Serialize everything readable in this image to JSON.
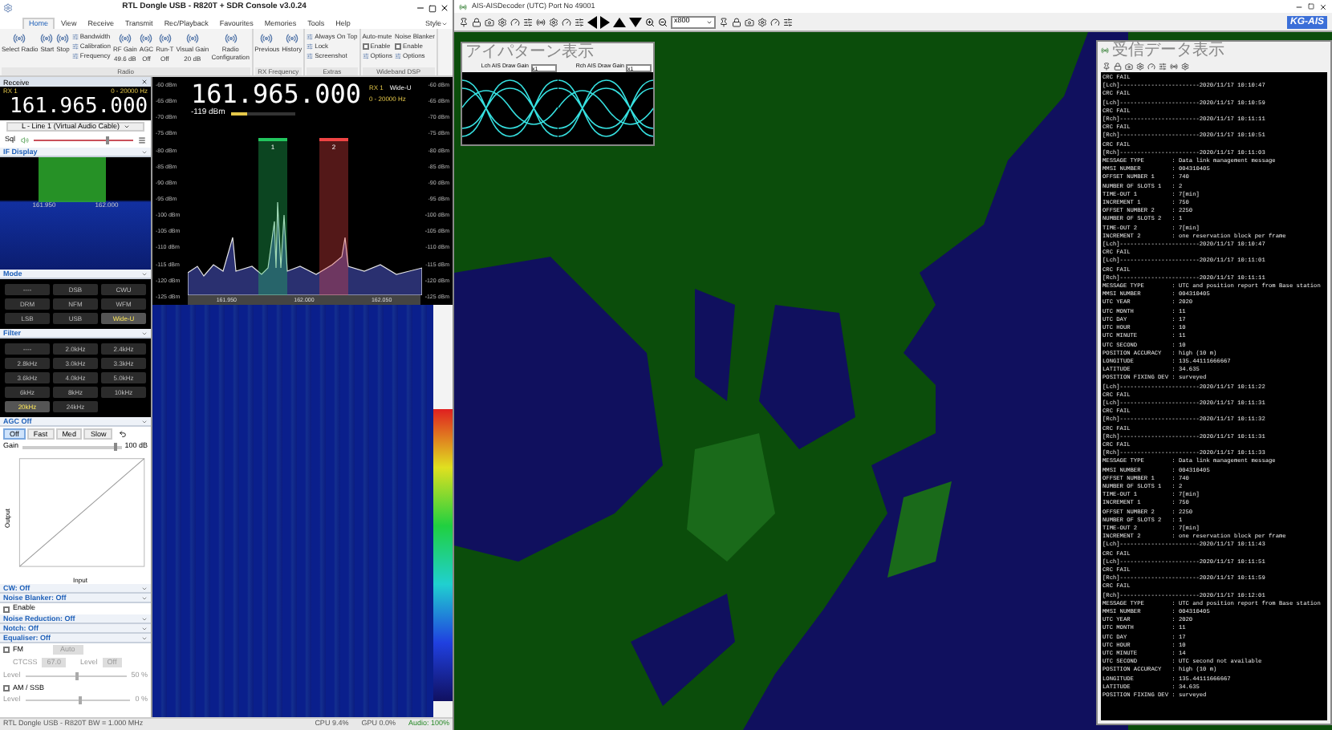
{
  "sdr": {
    "title": "RTL Dongle USB - R820T + SDR Console v3.0.24",
    "tabs": [
      {
        "label": "Home",
        "selected": true
      },
      {
        "label": "View",
        "selected": false
      },
      {
        "label": "Receive",
        "selected": false
      },
      {
        "label": "Transmit",
        "selected": false
      },
      {
        "label": "Rec/Playback",
        "selected": false
      },
      {
        "label": "Favourites",
        "selected": false
      },
      {
        "label": "Memories",
        "selected": false
      },
      {
        "label": "Tools",
        "selected": false
      },
      {
        "label": "Help",
        "selected": false
      }
    ],
    "style": "Style",
    "groups": [
      {
        "label": "Radio",
        "columns": [
          [
            {
              "kind": "large",
              "label": "Select Radio"
            }
          ],
          [
            {
              "kind": "large",
              "label": "Start"
            }
          ],
          [
            {
              "kind": "large",
              "label": "Stop"
            }
          ],
          [
            {
              "kind": "small",
              "label": "Bandwidth"
            },
            {
              "kind": "small",
              "label": "Calibration"
            },
            {
              "kind": "small",
              "label": "Frequency"
            }
          ],
          [
            {
              "kind": "large",
              "label": "RF Gain",
              "value": "49.6 dB"
            }
          ],
          [
            {
              "kind": "large",
              "label": "AGC",
              "value": "Off"
            }
          ],
          [
            {
              "kind": "large",
              "label": "Run-T",
              "value": "Off"
            }
          ],
          [
            {
              "kind": "large",
              "label": "Visual Gain",
              "value": "20 dB"
            }
          ],
          [
            {
              "kind": "large",
              "label": "Radio Configuration"
            }
          ]
        ]
      },
      {
        "label": "RX Frequency",
        "columns": [
          [
            {
              "kind": "large",
              "label": "Previous"
            }
          ],
          [
            {
              "kind": "large",
              "label": "History"
            }
          ]
        ]
      },
      {
        "label": "Extras",
        "columns": [
          [
            {
              "kind": "small",
              "label": "Always On Top"
            },
            {
              "kind": "small",
              "label": "Lock"
            },
            {
              "kind": "small",
              "label": "Screenshot"
            }
          ]
        ]
      },
      {
        "label": "Wideband DSP",
        "columns": [
          [
            {
              "kind": "heading",
              "label": "Auto-mute"
            },
            {
              "kind": "check",
              "label": "Enable",
              "checked": false
            },
            {
              "kind": "small",
              "label": "Options"
            }
          ],
          [
            {
              "kind": "heading",
              "label": "Noise Blanker"
            },
            {
              "kind": "check",
              "label": "Enable",
              "checked": false
            },
            {
              "kind": "small",
              "label": "Options"
            }
          ]
        ]
      }
    ],
    "receive": {
      "title": "Receive",
      "rx": "RX 1",
      "range": "0 - 20000 Hz",
      "frequency": "161.965.000",
      "audio_device": "L - Line 1 (Virtual Audio Cable)",
      "squelch": "Sql",
      "volume": {
        "level": 0.72
      }
    },
    "sections": [
      {
        "kind": "if_display",
        "title": "IF Display",
        "labels": [
          "161.950",
          "162.000"
        ]
      },
      {
        "kind": "buttons",
        "title": "Mode",
        "buttons": [
          {
            "label": "----",
            "selected": false
          },
          {
            "label": "DSB",
            "selected": false
          },
          {
            "label": "CWU",
            "selected": false
          },
          {
            "label": "DRM",
            "selected": false
          },
          {
            "label": "NFM",
            "selected": false
          },
          {
            "label": "WFM",
            "selected": false
          },
          {
            "label": "LSB",
            "selected": false
          },
          {
            "label": "USB",
            "selected": false
          },
          {
            "label": "Wide-U",
            "selected": true
          }
        ]
      },
      {
        "kind": "buttons",
        "title": "Filter",
        "buttons": [
          {
            "label": "----",
            "selected": false
          },
          {
            "label": "2.0kHz",
            "selected": false
          },
          {
            "label": "2.4kHz",
            "selected": false
          },
          {
            "label": "2.8kHz",
            "selected": false
          },
          {
            "label": "3.0kHz",
            "selected": false
          },
          {
            "label": "3.3kHz",
            "selected": false
          },
          {
            "label": "3.6kHz",
            "selected": false
          },
          {
            "label": "4.0kHz",
            "selected": false
          },
          {
            "label": "5.0kHz",
            "selected": false
          },
          {
            "label": "6kHz",
            "selected": false
          },
          {
            "label": "8kHz",
            "selected": false
          },
          {
            "label": "10kHz",
            "selected": false
          },
          {
            "label": "20kHz",
            "selected": true
          },
          {
            "label": "24kHz",
            "selected": false
          }
        ]
      },
      {
        "kind": "agc",
        "title": "AGC Off",
        "modes": [
          {
            "label": "Off",
            "selected": true
          },
          {
            "label": "Fast",
            "selected": false
          },
          {
            "label": "Med",
            "selected": false
          },
          {
            "label": "Slow",
            "selected": false
          }
        ],
        "gain_label": "Gain",
        "gain_value": "100 dB",
        "gain": {
          "level": 0.92
        },
        "xlabel": "Input",
        "ylabel": "Output"
      },
      {
        "kind": "header",
        "title": "CW: Off"
      },
      {
        "kind": "header",
        "title": "Noise Blanker: Off"
      },
      {
        "kind": "check",
        "label": "Enable",
        "checked": false
      },
      {
        "kind": "header",
        "title": "Noise Reduction: Off"
      },
      {
        "kind": "header",
        "title": "Notch: Off"
      },
      {
        "kind": "header",
        "title": "Equaliser: Off"
      },
      {
        "kind": "fm",
        "label": "FM",
        "checked": false,
        "button": "Auto",
        "ctcss": "CTCSS",
        "ctcss_value": "67.0",
        "level_label": "Level",
        "level_value": "Off"
      },
      {
        "kind": "slider",
        "label": "Level",
        "value": "50 %",
        "level": 0.5
      },
      {
        "kind": "check",
        "label": "AM / SSB",
        "checked": false
      },
      {
        "kind": "slider",
        "label": "Level",
        "value": "0 %",
        "level": 0.5
      }
    ],
    "display": {
      "frequency": "161.965.000",
      "rx": "RX 1",
      "mode": "Wide-U",
      "range": "0 - 20000 Hz",
      "signal": "-119 dBm",
      "meter": {
        "level": 0.25
      },
      "y_labels_left": [
        "-60 dBm",
        "-65 dBm",
        "-70 dBm",
        "-75 dBm",
        "-80 dBm",
        "-85 dBm",
        "-90 dBm",
        "-95 dBm",
        "-100 dBm",
        "-105 dBm",
        "-110 dBm",
        "-115 dBm",
        "-120 dBm",
        "-125 dBm"
      ],
      "y_labels_right": [
        "-60 dBm",
        "-65 dBm",
        "-70 dBm",
        "-75 dBm",
        "-80 dBm",
        "-85 dBm",
        "-90 dBm",
        "-95 dBm",
        "-100 dBm",
        "-105 dBm",
        "-110 dBm",
        "-115 dBm",
        "-120 dBm",
        "-125 dBm"
      ],
      "x_labels": [
        "161.950",
        "162.000",
        "162.050"
      ],
      "vfos": [
        {
          "label": "1",
          "color": "#22c55e"
        },
        {
          "label": "2",
          "color": "#ef4444"
        }
      ]
    },
    "status": {
      "left": "RTL Dongle USB - R820T BW = 1.000 MHz",
      "cpu": "CPU 9.4%",
      "gpu": "GPU 0.0%",
      "audio": "Audio: 100%"
    }
  },
  "decoder": {
    "title": "AIS-AISDecoder (UTC) Port No 49001",
    "zoom": "x800",
    "logo": "KG-AIS",
    "eye_window": {
      "title": "アイパターン表示",
      "channels": [
        {
          "label": "Lch AIS Draw Gain",
          "gain": "x1"
        },
        {
          "label": "Rch AIS Draw Gain",
          "gain": "x1"
        }
      ]
    },
    "log_window": {
      "title": "受信データ表示",
      "lines": [
        "CRC FAIL",
        "[Lch]-----------------------2020/11/17 10:10:47",
        "CRC FAIL",
        "[Lch]-----------------------2020/11/17 10:10:59",
        "CRC FAIL",
        "[Rch]-----------------------2020/11/17 10:11:11",
        "CRC FAIL",
        "[Rch]-----------------------2020/11/17 10:10:51",
        "CRC FAIL",
        "[Rch]-----------------------2020/11/17 10:11:03",
        "MESSAGE TYPE        : Data link management message",
        "MMSI NUMBER         : 004310405",
        "OFFSET NUMBER 1     : 740",
        "NUMBER OF SLOTS 1   : 2",
        "TIME-OUT 1          : 7[min]",
        "INCREMENT 1         : 750",
        "OFFSET NUMBER 2     : 2250",
        "NUMBER OF SLOTS 2   : 1",
        "TIME-OUT 2          : 7[min]",
        "INCREMENT 2         : one reservation block per frame",
        "[Lch]-----------------------2020/11/17 10:10:47",
        "CRC FAIL",
        "[Lch]-----------------------2020/11/17 10:11:01",
        "CRC FAIL",
        "[Rch]-----------------------2020/11/17 10:11:11",
        "MESSAGE TYPE        : UTC and position report from Base station",
        "MMSI NUMBER         : 004310405",
        "UTC YEAR            : 2020",
        "UTC MONTH           : 11",
        "UTC DAY             : 17",
        "UTC HOUR            : 10",
        "UTC MINUTE          : 11",
        "UTC SECOND          : 10",
        "POSITION ACCURACY   : high (10 m)",
        "LONGITUDE           : 135.44111666667",
        "LATITUDE            : 34.635",
        "POSITION FIXING DEV : surveyed",
        "[Lch]-----------------------2020/11/17 10:11:22",
        "CRC FAIL",
        "[Lch]-----------------------2020/11/17 10:11:31",
        "CRC FAIL",
        "[Rch]-----------------------2020/11/17 10:11:32",
        "CRC FAIL",
        "[Rch]-----------------------2020/11/17 10:11:31",
        "CRC FAIL",
        "[Rch]-----------------------2020/11/17 10:11:33",
        "MESSAGE TYPE        : Data link management message",
        "MMSI NUMBER         : 004310405",
        "OFFSET NUMBER 1     : 740",
        "NUMBER OF SLOTS 1   : 2",
        "TIME-OUT 1          : 7[min]",
        "INCREMENT 1         : 750",
        "OFFSET NUMBER 2     : 2250",
        "NUMBER OF SLOTS 2   : 1",
        "TIME-OUT 2          : 7[min]",
        "INCREMENT 2         : one reservation block per frame",
        "[Lch]-----------------------2020/11/17 10:11:43",
        "CRC FAIL",
        "[Lch]-----------------------2020/11/17 10:11:51",
        "CRC FAIL",
        "[Rch]-----------------------2020/11/17 10:11:59",
        "CRC FAIL",
        "[Rch]-----------------------2020/11/17 10:12:01",
        "MESSAGE TYPE        : UTC and position report from Base station",
        "MMSI NUMBER         : 004310405",
        "UTC YEAR            : 2020",
        "UTC MONTH           : 11",
        "UTC DAY             : 17",
        "UTC HOUR            : 10",
        "UTC MINUTE          : 14",
        "UTC SECOND          : UTC second not available",
        "POSITION ACCURACY   : high (10 m)",
        "LONGITUDE           : 135.44111666667",
        "LATITUDE            : 34.635",
        "POSITION FIXING DEV : surveyed"
      ]
    }
  }
}
